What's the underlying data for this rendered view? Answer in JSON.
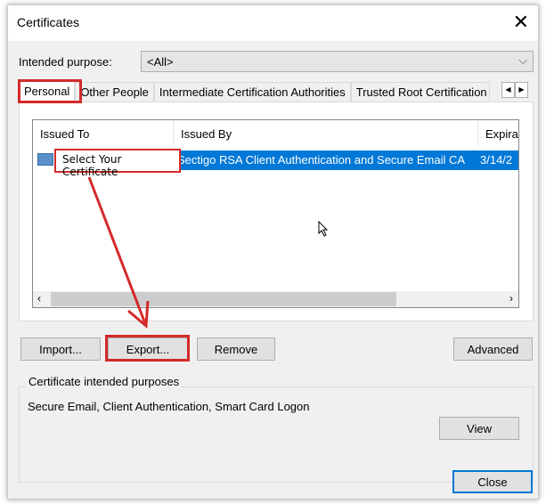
{
  "window": {
    "title": "Certificates",
    "close_icon": "close-icon"
  },
  "purpose": {
    "label": "Intended purpose:",
    "value": "<All>"
  },
  "tabs": [
    {
      "label": "Personal",
      "active": true
    },
    {
      "label": "Other People"
    },
    {
      "label": "Intermediate Certification Authorities"
    },
    {
      "label": "Trusted Root Certification"
    }
  ],
  "list": {
    "columns": [
      "Issued To",
      "Issued By",
      "Expirat"
    ],
    "rows": [
      {
        "issued_to": "",
        "issued_by": "Sectigo RSA Client Authentication and Secure Email CA",
        "expiration": "3/14/2"
      }
    ]
  },
  "annotation": {
    "callout": "Select Your Certificate",
    "color": "#d42a2a"
  },
  "buttons": {
    "import": "Import...",
    "export": "Export...",
    "remove": "Remove",
    "advanced": "Advanced",
    "view": "View",
    "close": "Close"
  },
  "purposes": {
    "label": "Certificate intended purposes",
    "value": "Secure Email, Client Authentication, Smart Card Logon"
  },
  "colors": {
    "selection": "#0078d7",
    "accent_border": "#0078d7"
  }
}
